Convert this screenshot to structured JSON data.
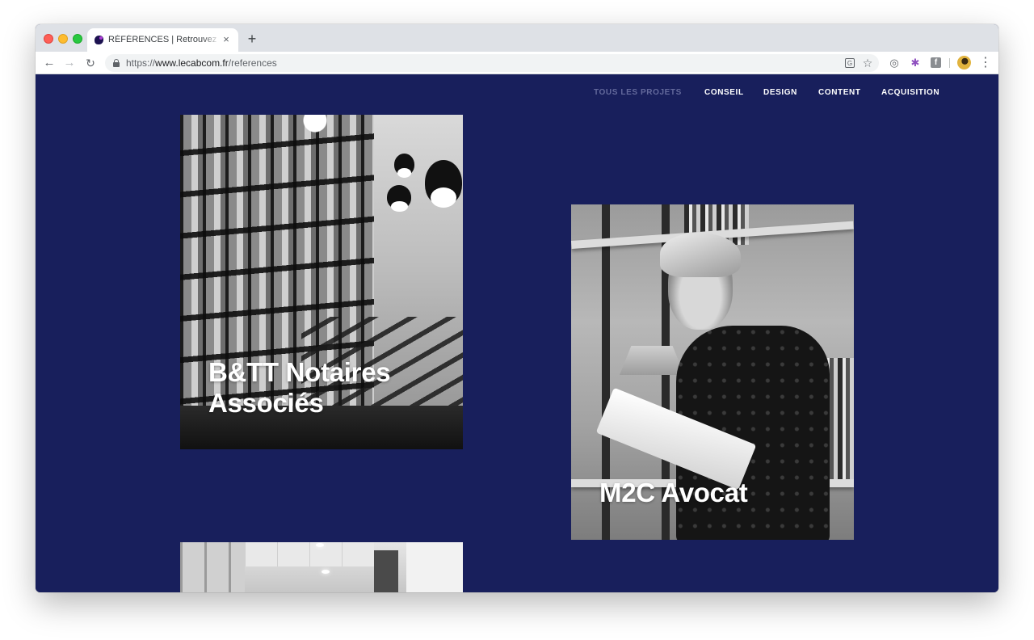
{
  "browser": {
    "tab_title": "RÉFÉRENCES | Retrouvez l'ens",
    "tab_close": "×",
    "new_tab": "+",
    "url_scheme": "https://",
    "url_host": "www.lecabcom.fr",
    "url_path": "/references",
    "nav": {
      "back": "←",
      "forward": "→",
      "reload": "↻"
    },
    "icons": {
      "translate": "translate-icon",
      "bookmark": "star-icon",
      "globe_extension": "globe-icon",
      "puzzle_extension": "puzzle-icon",
      "facebook_extension": "facebook-icon",
      "profile": "avatar",
      "menu": "kebab-menu-icon"
    },
    "translate_glyph": "G",
    "star_glyph": "☆",
    "globe_glyph": "◎",
    "puzzle_glyph": "✱",
    "fb_glyph": "f",
    "menu_glyph": "⋮"
  },
  "site": {
    "background": "#181f5c",
    "nav": [
      {
        "label": "TOUS LES PROJETS",
        "active": false
      },
      {
        "label": "CONSEIL",
        "active": true
      },
      {
        "label": "DESIGN",
        "active": true
      },
      {
        "label": "CONTENT",
        "active": true
      },
      {
        "label": "ACQUISITION",
        "active": true
      }
    ],
    "projects": [
      {
        "title_line1": "B&TT Notaires",
        "title_line2": "Associés"
      },
      {
        "title_line1": "M2C Avocat"
      },
      {
        "title_line1": ""
      }
    ]
  }
}
